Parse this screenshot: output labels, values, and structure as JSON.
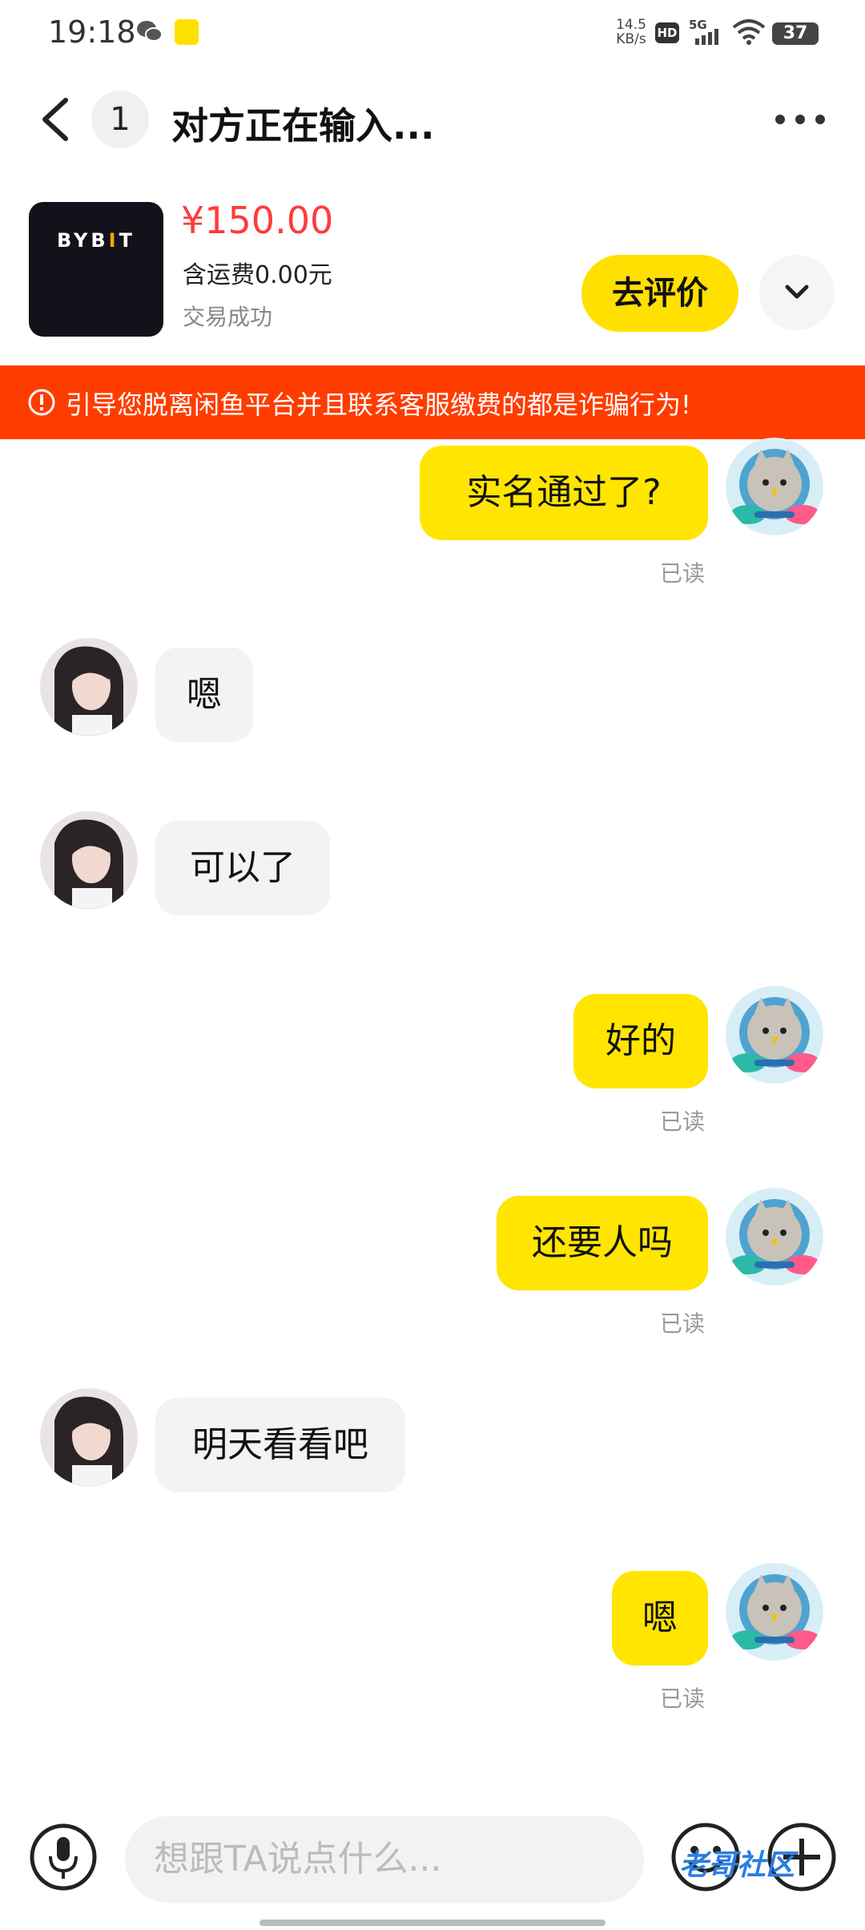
{
  "status_bar": {
    "time": "19:18",
    "net_speed_value": "14.5",
    "net_speed_unit": "KB/s",
    "hd": "HD",
    "network": "5G",
    "battery": "37"
  },
  "header": {
    "unread_count": "1",
    "title": "对方正在输入..."
  },
  "product": {
    "image_text_main": "BYB",
    "image_text_accent": "I",
    "image_text_end": "T",
    "price": "¥150.00",
    "shipping": "含运费0.00元",
    "status": "交易成功",
    "review_button": "去评价"
  },
  "warning": {
    "text": "引导您脱离闲鱼平台并且联系客服缴费的都是诈骗行为!"
  },
  "messages": [
    {
      "side": "right",
      "text": "实名通过了?",
      "read": "已读"
    },
    {
      "side": "left",
      "text": "嗯"
    },
    {
      "side": "left",
      "text": "可以了"
    },
    {
      "side": "right",
      "text": "好的",
      "read": "已读"
    },
    {
      "side": "right",
      "text": "还要人吗",
      "read": "已读"
    },
    {
      "side": "left",
      "text": "明天看看吧"
    },
    {
      "side": "right",
      "text": "嗯",
      "read": "已读"
    }
  ],
  "input": {
    "placeholder": "想跟TA说点什么..."
  },
  "watermark": "老哥社区",
  "colors": {
    "accent_yellow": "#ffe500",
    "warning_red": "#ff3c00",
    "price_red": "#ff3b3b"
  }
}
